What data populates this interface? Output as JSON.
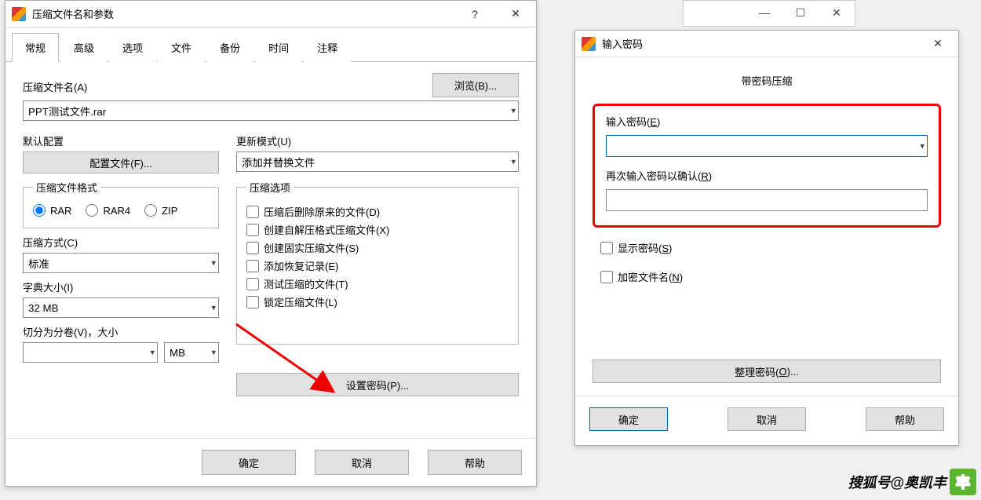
{
  "archive_dialog": {
    "title": "压缩文件名和参数",
    "tabs": [
      "常规",
      "高级",
      "选项",
      "文件",
      "备份",
      "时间",
      "注释"
    ],
    "filename_label": "压缩文件名(A)",
    "filename_value": "PPT测试文件.rar",
    "browse_btn": "浏览(B)...",
    "default_profile_label": "默认配置",
    "profile_btn": "配置文件(F)...",
    "update_mode_label": "更新模式(U)",
    "update_mode_value": "添加并替换文件",
    "format_group": "压缩文件格式",
    "formats": {
      "rar": "RAR",
      "rar4": "RAR4",
      "zip": "ZIP"
    },
    "method_label": "压缩方式(C)",
    "method_value": "标准",
    "dict_label": "字典大小(I)",
    "dict_value": "32 MB",
    "split_label": "切分为分卷(V)，大小",
    "split_unit": "MB",
    "options_group": "压缩选项",
    "options": {
      "delete_after": "压缩后删除原来的文件(D)",
      "sfx": "创建自解压格式压缩文件(X)",
      "solid": "创建固实压缩文件(S)",
      "recovery": "添加恢复记录(E)",
      "test": "测试压缩的文件(T)",
      "lock": "锁定压缩文件(L)"
    },
    "set_password_btn": "设置密码(P)...",
    "ok": "确定",
    "cancel": "取消",
    "help": "帮助"
  },
  "password_dialog": {
    "title": "输入密码",
    "header": "带密码压缩",
    "enter_label": "输入密码(E)",
    "confirm_label": "再次输入密码以确认(R)",
    "show_password": "显示密码(S)",
    "encrypt_names": "加密文件名(N)",
    "organize_btn": "整理密码(O)...",
    "ok": "确定",
    "cancel": "取消",
    "help": "帮助"
  },
  "watermark": "搜狐号@奥凯丰"
}
